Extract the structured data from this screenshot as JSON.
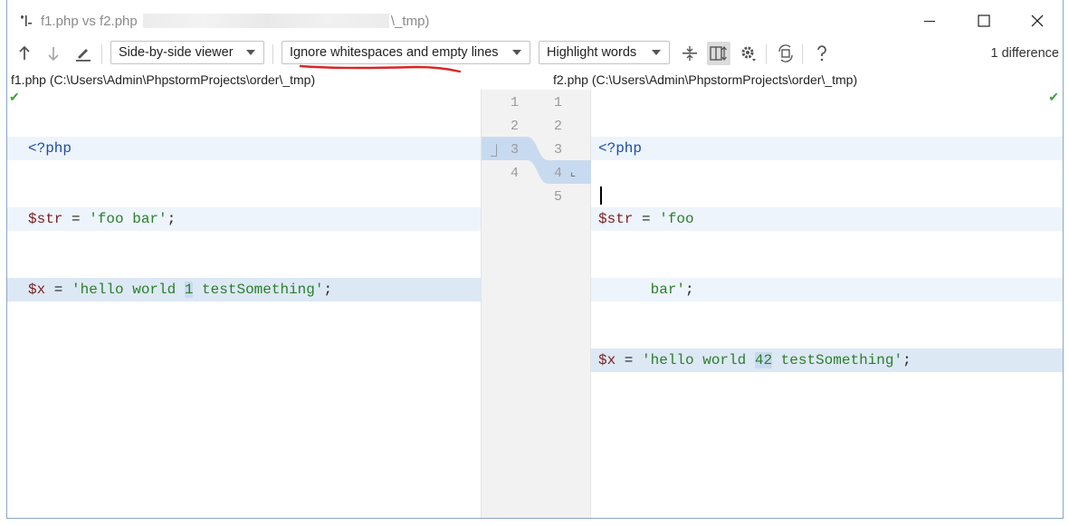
{
  "window": {
    "title_left": "f1.php vs f2.php",
    "title_right": "\\_tmp)"
  },
  "toolbar": {
    "viewer": "Side-by-side viewer",
    "whitespace": "Ignore whitespaces and empty lines",
    "highlight": "Highlight words",
    "diff_count": "1 difference"
  },
  "left": {
    "path": "f1.php (C:\\Users\\Admin\\PhpstormProjects\\order\\_tmp)",
    "line_numbers": [
      "1",
      "2",
      "3",
      "4"
    ]
  },
  "right": {
    "path": "f2.php (C:\\Users\\Admin\\PhpstormProjects\\order\\_tmp)",
    "line_numbers": [
      "1",
      "2",
      "3",
      "4",
      "5"
    ]
  },
  "code_left": {
    "l1": "<?php",
    "l2_var": "$str",
    "l2_eq": " = ",
    "l2_str": "'foo bar'",
    "l2_end": ";",
    "l3_var": "$x",
    "l3_eq": " = ",
    "l3_str_a": "'hello world ",
    "l3_str_hl": "1",
    "l3_str_b": " testSomething'",
    "l3_end": ";"
  },
  "code_right": {
    "l1": "<?php",
    "l2_var": "$str",
    "l2_eq": " = ",
    "l2_str": "'foo",
    "l3_str": "      bar'",
    "l3_end": ";",
    "l4_var": "$x",
    "l4_eq": " = ",
    "l4_str_a": "'hello world ",
    "l4_str_hl": "42",
    "l4_str_b": " testSomething'",
    "l4_end": ";"
  },
  "colors": {
    "accent": "#3574f0",
    "annotation_red": "#d92626",
    "diff_fill": "#c8daf0"
  },
  "icons": [
    "app-diff-icon",
    "minimize-icon",
    "maximize-icon",
    "close-icon",
    "prev-diff-icon",
    "next-diff-icon",
    "edit-icon",
    "collapse-unchanged-icon",
    "sync-scroll-icon",
    "settings-icon",
    "revert-icon",
    "help-icon",
    "check-icon"
  ]
}
